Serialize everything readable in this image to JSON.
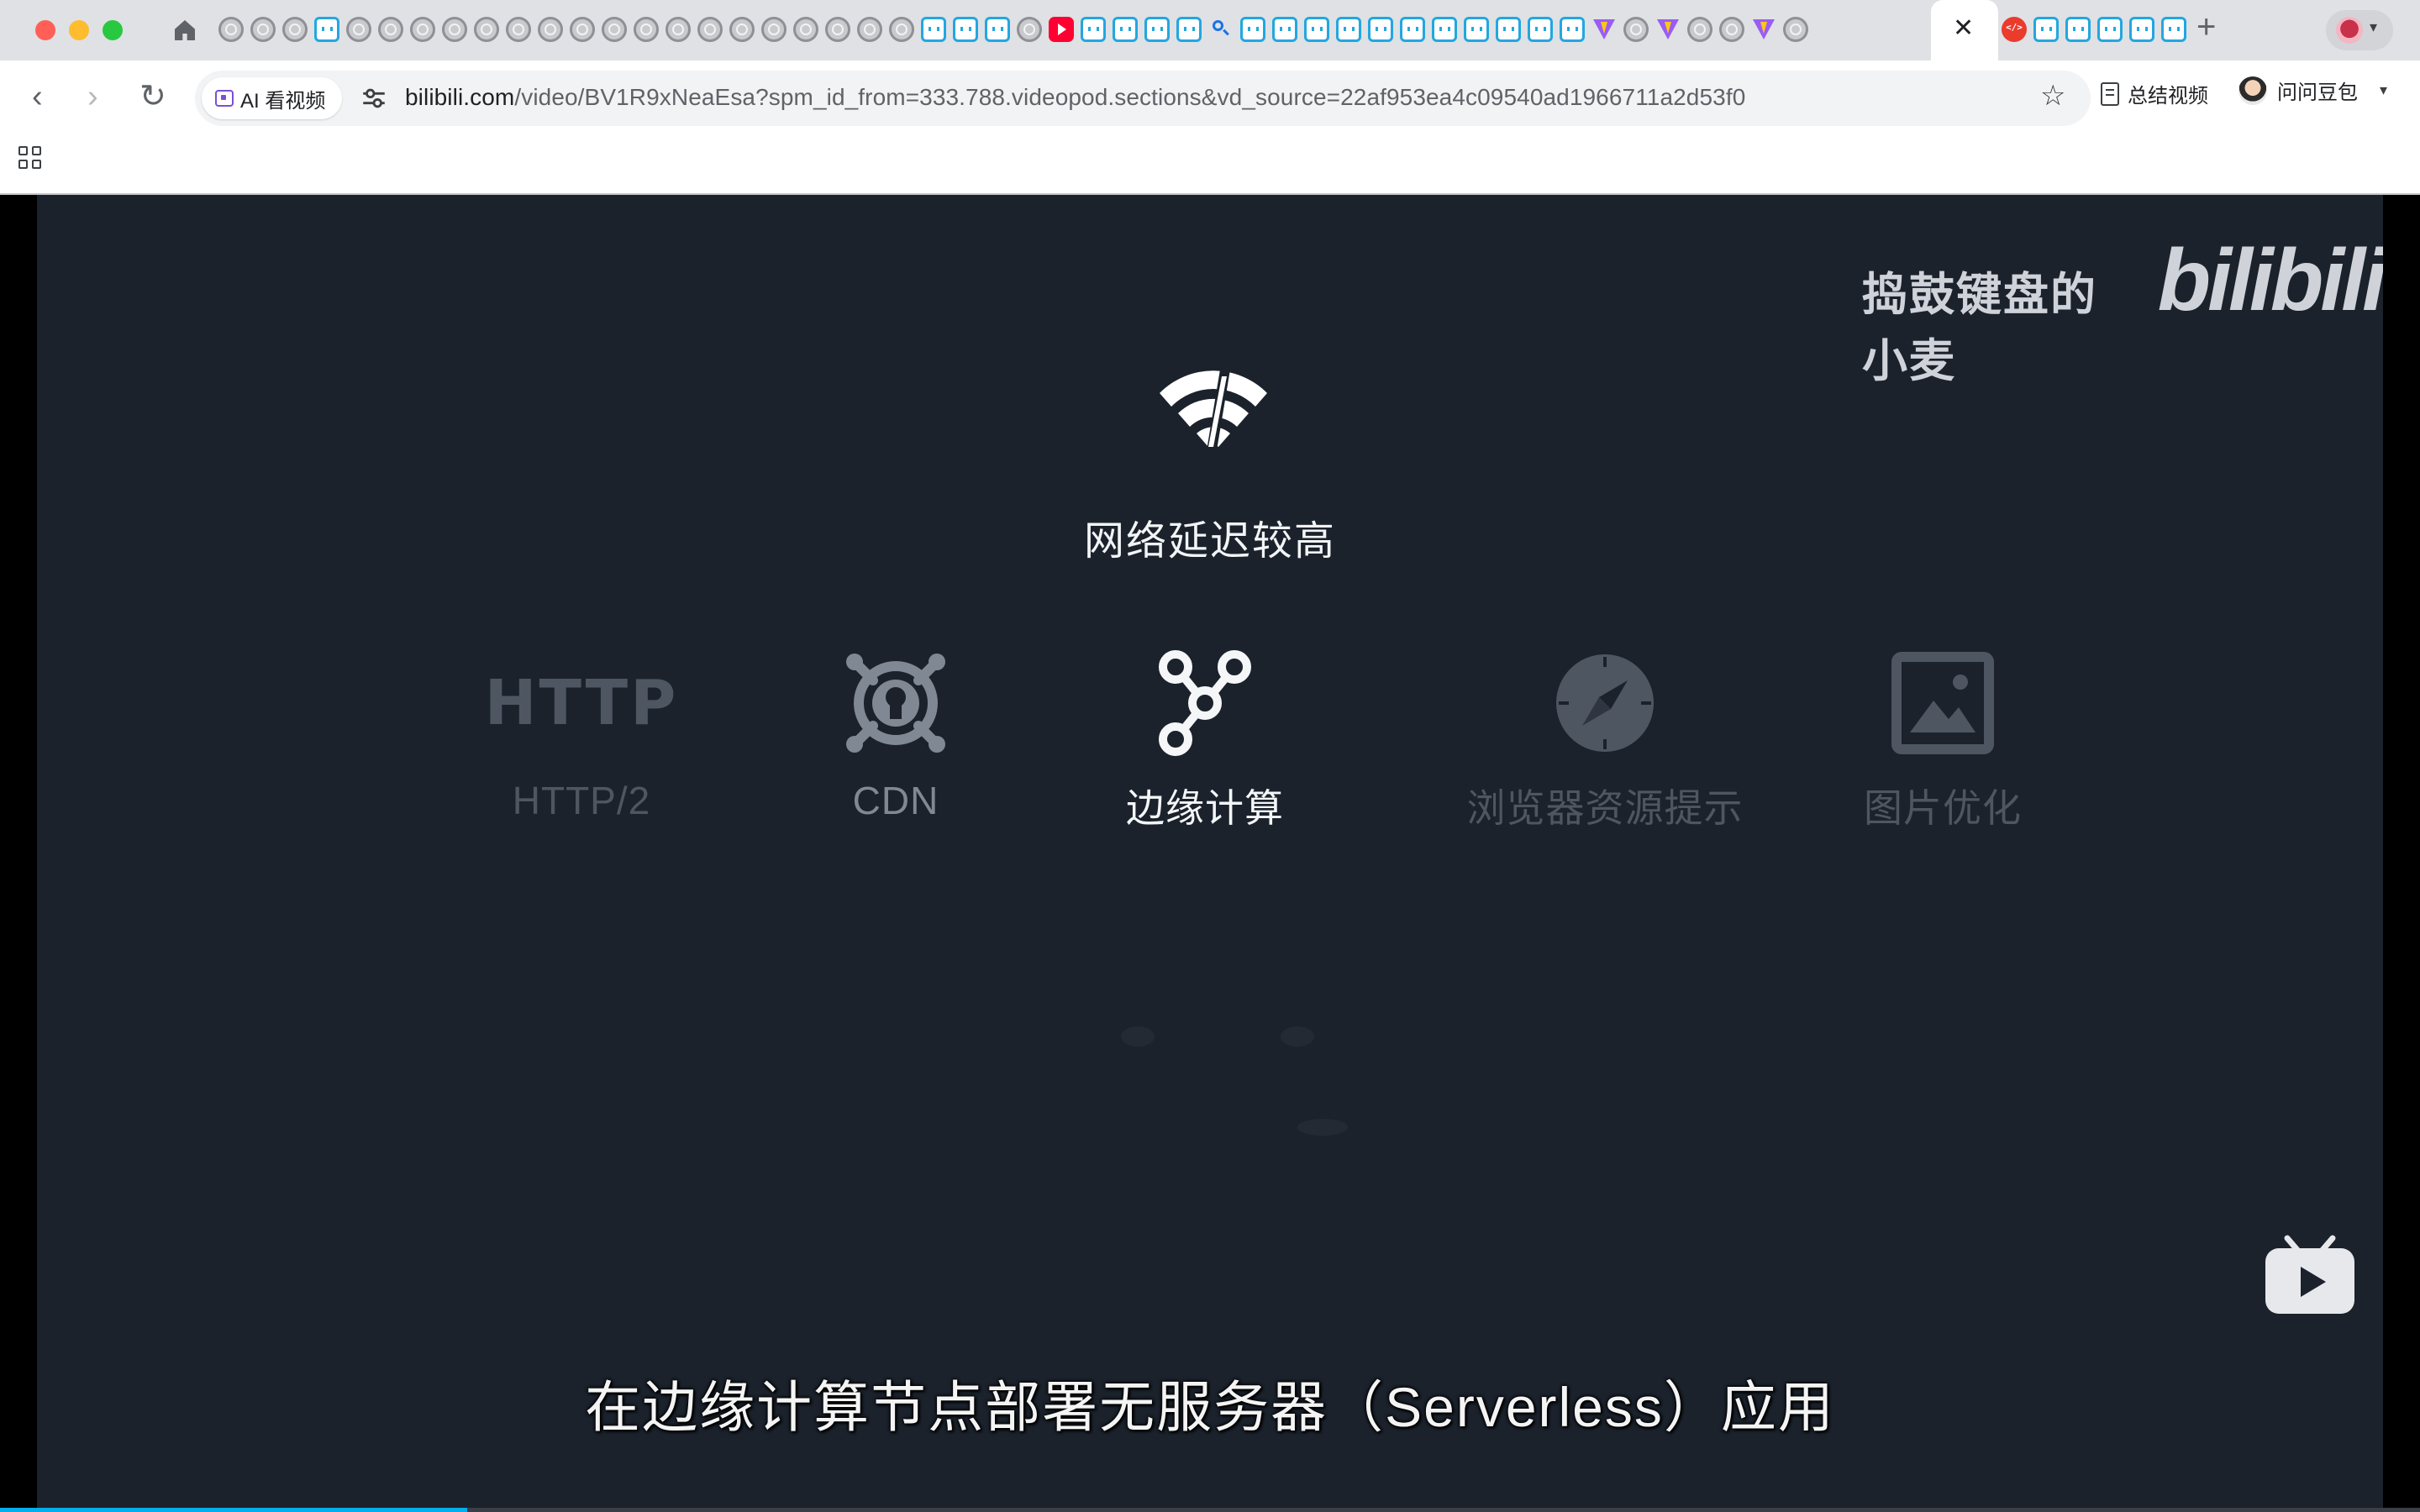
{
  "browser": {
    "tab_icons": [
      "globe",
      "globe",
      "globe",
      "bili",
      "globe",
      "globe",
      "globe",
      "globe",
      "globe",
      "globe",
      "globe",
      "globe",
      "globe",
      "globe",
      "globe",
      "globe",
      "globe",
      "globe",
      "globe",
      "globe",
      "globe",
      "globe",
      "bili",
      "bili",
      "bili",
      "globe",
      "youtube",
      "bili",
      "bili",
      "bili",
      "bili",
      "search",
      "bili",
      "bili",
      "bili",
      "bili",
      "bili",
      "bili",
      "bili",
      "bili",
      "bili",
      "bili",
      "bili",
      "vite",
      "globe",
      "vite",
      "globe",
      "globe",
      "vite",
      "globe"
    ],
    "active_tab_close": "✕",
    "right_tab_icons": [
      "red",
      "bili",
      "bili",
      "bili",
      "bili",
      "bili"
    ],
    "new_tab": "+",
    "toolbar": {
      "back": "‹",
      "forward": "›",
      "reload": "↻",
      "ai_chip_label": "AI 看视频",
      "url_host": "bilibili.com",
      "url_rest": "/video/BV1R9xNeaEsa?spm_id_from=333.788.videopod.sections&vd_source=22af953ea4c09540ad1966711a2d53f0",
      "star": "☆",
      "summary_label": "总结视频",
      "doubao_label": "问问豆包",
      "doubao_caret": "▾",
      "profile_caret": "▾"
    }
  },
  "video": {
    "watermark_name": "捣鼓键盘的小麦",
    "watermark_logo": "bilibili",
    "headline": "网络延迟较高",
    "features": [
      {
        "glyph": "HTTP",
        "label": "HTTP/2",
        "icon": "http-text-icon",
        "state": "dim"
      },
      {
        "glyph": "",
        "label": "CDN",
        "icon": "cdn-icon",
        "state": "mid"
      },
      {
        "glyph": "",
        "label": "边缘计算",
        "icon": "edge-network-icon",
        "state": "active"
      },
      {
        "glyph": "",
        "label": "浏览器资源提示",
        "icon": "compass-icon",
        "state": "dim"
      },
      {
        "glyph": "",
        "label": "图片优化",
        "icon": "image-icon",
        "state": "dim"
      }
    ],
    "subtitle": "在边缘计算节点部署无服务器（Serverless）应用",
    "progress_fraction": 0.193,
    "colors": {
      "bg": "#1b222c",
      "accent": "#00aeec",
      "dim": "#4e5661",
      "mid": "#808894",
      "active": "#f4f6f8"
    }
  }
}
